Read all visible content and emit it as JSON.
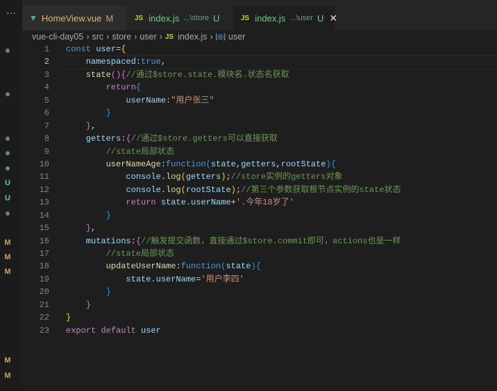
{
  "tabs": [
    {
      "label": "HomeView.vue",
      "badge": "M",
      "icon": "vue-icon",
      "dirty": true
    },
    {
      "label": "index.js",
      "path": "...\\store",
      "badge": "U",
      "icon": "js-icon"
    },
    {
      "label": "index.js",
      "path": "...\\user",
      "badge": "U",
      "icon": "js-icon",
      "active": true
    }
  ],
  "more_label": "···",
  "close_glyph": "✕",
  "breadcrumb": [
    "vue-cli-day05",
    "src",
    "store",
    "user",
    "index.js",
    "user"
  ],
  "gutter_markers": [
    "U",
    "U",
    "M",
    "M",
    "M",
    "M",
    "M"
  ],
  "lines": [
    [
      [
        "const ",
        "k"
      ],
      [
        "user",
        "v"
      ],
      [
        "=",
        "t"
      ],
      [
        "{",
        "b"
      ]
    ],
    [
      [
        "    namespaced",
        "v"
      ],
      [
        ":",
        "t"
      ],
      [
        "true",
        "k"
      ],
      [
        ",",
        "t"
      ]
    ],
    [
      [
        "    state",
        "f"
      ],
      [
        "()",
        "b2"
      ],
      [
        "{",
        "b2"
      ],
      [
        "//通过$store.state.模块名.状态名获取",
        "c"
      ]
    ],
    [
      [
        "        return",
        "p"
      ],
      [
        "{",
        "b3"
      ]
    ],
    [
      [
        "            userName",
        "v"
      ],
      [
        ":",
        "t"
      ],
      [
        "\"用户张三\"",
        "s"
      ]
    ],
    [
      [
        "        }",
        "b3"
      ]
    ],
    [
      [
        "    }",
        "b2"
      ],
      [
        ",",
        "t"
      ]
    ],
    [
      [
        "    getters",
        "v"
      ],
      [
        ":",
        "t"
      ],
      [
        "{",
        "b2"
      ],
      [
        "//通过$store.getters可以直接获取",
        "c"
      ]
    ],
    [
      [
        "        //state局部状态",
        "c"
      ]
    ],
    [
      [
        "        userNameAge",
        "f"
      ],
      [
        ":",
        "t"
      ],
      [
        "function",
        "k"
      ],
      [
        "(",
        "b3"
      ],
      [
        "state",
        "v"
      ],
      [
        ",",
        "t"
      ],
      [
        "getters",
        "v"
      ],
      [
        ",",
        "t"
      ],
      [
        "rootState",
        "v"
      ],
      [
        ")",
        "b3"
      ],
      [
        "{",
        "b3"
      ]
    ],
    [
      [
        "            console",
        "v"
      ],
      [
        ".",
        "t"
      ],
      [
        "log",
        "f"
      ],
      [
        "(",
        "b"
      ],
      [
        "getters",
        "v"
      ],
      [
        ")",
        "b"
      ],
      [
        ";",
        "t"
      ],
      [
        "//store实例的getters对象",
        "c"
      ]
    ],
    [
      [
        "            console",
        "v"
      ],
      [
        ".",
        "t"
      ],
      [
        "log",
        "f"
      ],
      [
        "(",
        "b"
      ],
      [
        "rootState",
        "v"
      ],
      [
        ")",
        "b"
      ],
      [
        ";",
        "t"
      ],
      [
        "//第三个参数获取根节点实例的state状态",
        "c"
      ]
    ],
    [
      [
        "            return ",
        "p"
      ],
      [
        "state",
        "v"
      ],
      [
        ".",
        "t"
      ],
      [
        "userName",
        "v"
      ],
      [
        "+",
        "t"
      ],
      [
        "'.今年18岁了'",
        "s"
      ]
    ],
    [
      [
        "        }",
        "b3"
      ]
    ],
    [
      [
        "    }",
        "b2"
      ],
      [
        ",",
        "t"
      ]
    ],
    [
      [
        "    mutations",
        "v"
      ],
      [
        ":",
        "t"
      ],
      [
        "{",
        "b2"
      ],
      [
        "//触发提交函数，直接通过$store.commit即可，actions也是一样",
        "c"
      ]
    ],
    [
      [
        "        //state局部状态",
        "c"
      ]
    ],
    [
      [
        "        updateUserName",
        "f"
      ],
      [
        ":",
        "t"
      ],
      [
        "function",
        "k"
      ],
      [
        "(",
        "b3"
      ],
      [
        "state",
        "v"
      ],
      [
        ")",
        "b3"
      ],
      [
        "{",
        "b3"
      ]
    ],
    [
      [
        "            state",
        "v"
      ],
      [
        ".",
        "t"
      ],
      [
        "userName",
        "v"
      ],
      [
        "=",
        "t"
      ],
      [
        "'用户李四'",
        "s"
      ]
    ],
    [
      [
        "        }",
        "b3"
      ]
    ],
    [
      [
        "    }",
        "b2"
      ]
    ],
    [
      [
        "}",
        "b"
      ]
    ],
    [
      [
        "export ",
        "p"
      ],
      [
        "default ",
        "p"
      ],
      [
        "user",
        "v"
      ]
    ]
  ]
}
